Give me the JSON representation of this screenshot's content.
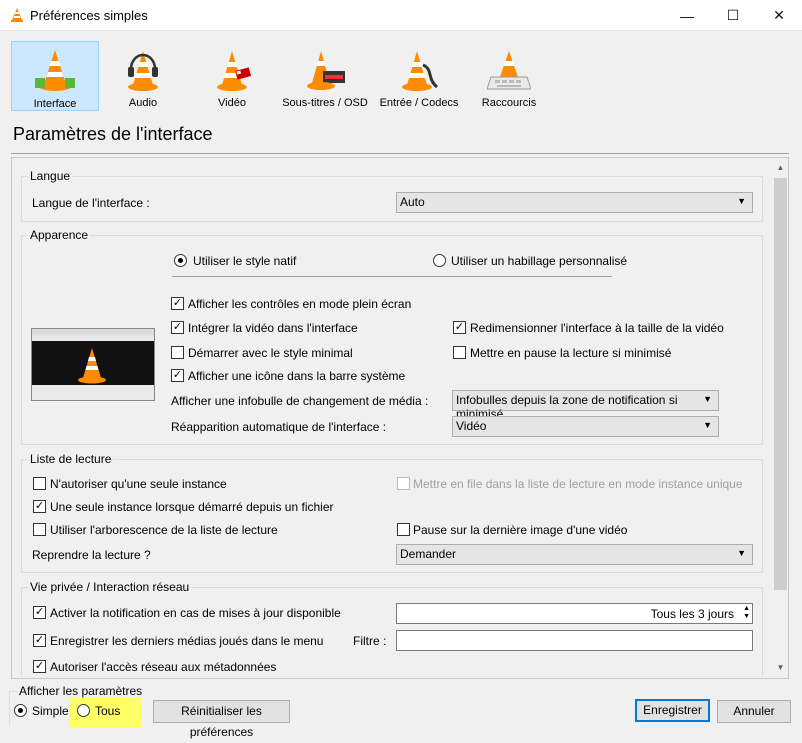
{
  "window": {
    "title": "Préférences simples",
    "controls": {
      "minimize": "—",
      "maximize": "☐",
      "close": "✕"
    }
  },
  "categories": [
    {
      "label": "Interface",
      "icon": "interface-cone-icon"
    },
    {
      "label": "Audio",
      "icon": "audio-headphones-cone-icon"
    },
    {
      "label": "Vidéo",
      "icon": "video-glasses-cone-icon"
    },
    {
      "label": "Sous-titres / OSD",
      "icon": "subtitles-cone-icon"
    },
    {
      "label": "Entrée / Codecs",
      "icon": "codecs-cable-cone-icon"
    },
    {
      "label": "Raccourcis",
      "icon": "shortcuts-keyboard-cone-icon"
    }
  ],
  "panel_title": "Paramètres de l'interface",
  "langue": {
    "title": "Langue",
    "label": "Langue de l'interface :",
    "value": "Auto"
  },
  "apparence": {
    "title": "Apparence",
    "radio_native": "Utiliser le style natif",
    "radio_skin": "Utiliser un habillage personnalisé",
    "cb_fullscreen": "Afficher les contrôles en mode plein écran",
    "cb_embed": "Intégrer la vidéo dans l'interface",
    "cb_resize": "Redimensionner l'interface à la taille de la vidéo",
    "cb_minimal": "Démarrer avec le style minimal",
    "cb_pause_min": "Mettre en pause la lecture si minimisé",
    "cb_systray": "Afficher une icône dans la barre système",
    "popup_label": "Afficher une infobulle de changement de média :",
    "popup_value": "Infobulles depuis la zone de notification si minimisé",
    "raise_label": "Réapparition automatique de l'interface :",
    "raise_value": "Vidéo"
  },
  "playlist": {
    "title": "Liste de lecture",
    "cb_one_instance": "N'autoriser qu'une seule instance",
    "cb_enqueue": "Mettre en file dans la liste de lecture en mode instance unique",
    "cb_one_instance_file": "Une seule instance lorsque démarré depuis un fichier",
    "cb_tree": "Utiliser l'arborescence de la liste de lecture",
    "cb_pause_last": "Pause sur la dernière image d'une vidéo",
    "resume_label": "Reprendre la lecture ?",
    "resume_value": "Demander"
  },
  "privacy": {
    "title": "Vie privée / Interaction réseau",
    "cb_updates": "Activer la notification en cas de mises à jour disponible",
    "updates_value": "Tous les 3 jours",
    "cb_recent": "Enregistrer les derniers médias joués dans le menu",
    "filter_label": "Filtre :",
    "filter_value": "",
    "cb_metadata": "Autoriser l'accès réseau aux métadonnées"
  },
  "footer": {
    "show_label": "Afficher les paramètres",
    "simple": "Simple",
    "all": "Tous",
    "reset": "Réinitialiser les préférences",
    "save": "Enregistrer",
    "cancel": "Annuler"
  },
  "colors": {
    "accent": "#0078d7",
    "highlight": "#ffff66",
    "selected_tab": "#cce8ff"
  }
}
